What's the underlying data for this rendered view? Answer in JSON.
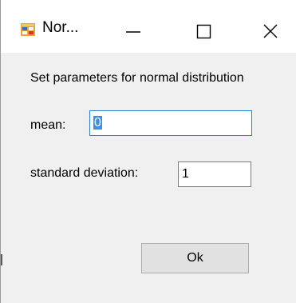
{
  "window": {
    "title": "Nor...",
    "controls": {
      "minimize_icon": "minimize-icon",
      "maximize_icon": "maximize-icon",
      "close_icon": "close-icon"
    }
  },
  "form": {
    "heading": "Set parameters for normal distribution",
    "mean": {
      "label": "mean:",
      "value": "0"
    },
    "standard_deviation": {
      "label": "standard deviation:",
      "value": "1"
    },
    "ok_label": "Ok"
  },
  "colors": {
    "window_bg": "#f0f0f0",
    "titlebar_bg": "#ffffff",
    "focus_border": "#2f7fd1",
    "selection": "#3f8ee4",
    "button_bg": "#e1e1e1"
  }
}
